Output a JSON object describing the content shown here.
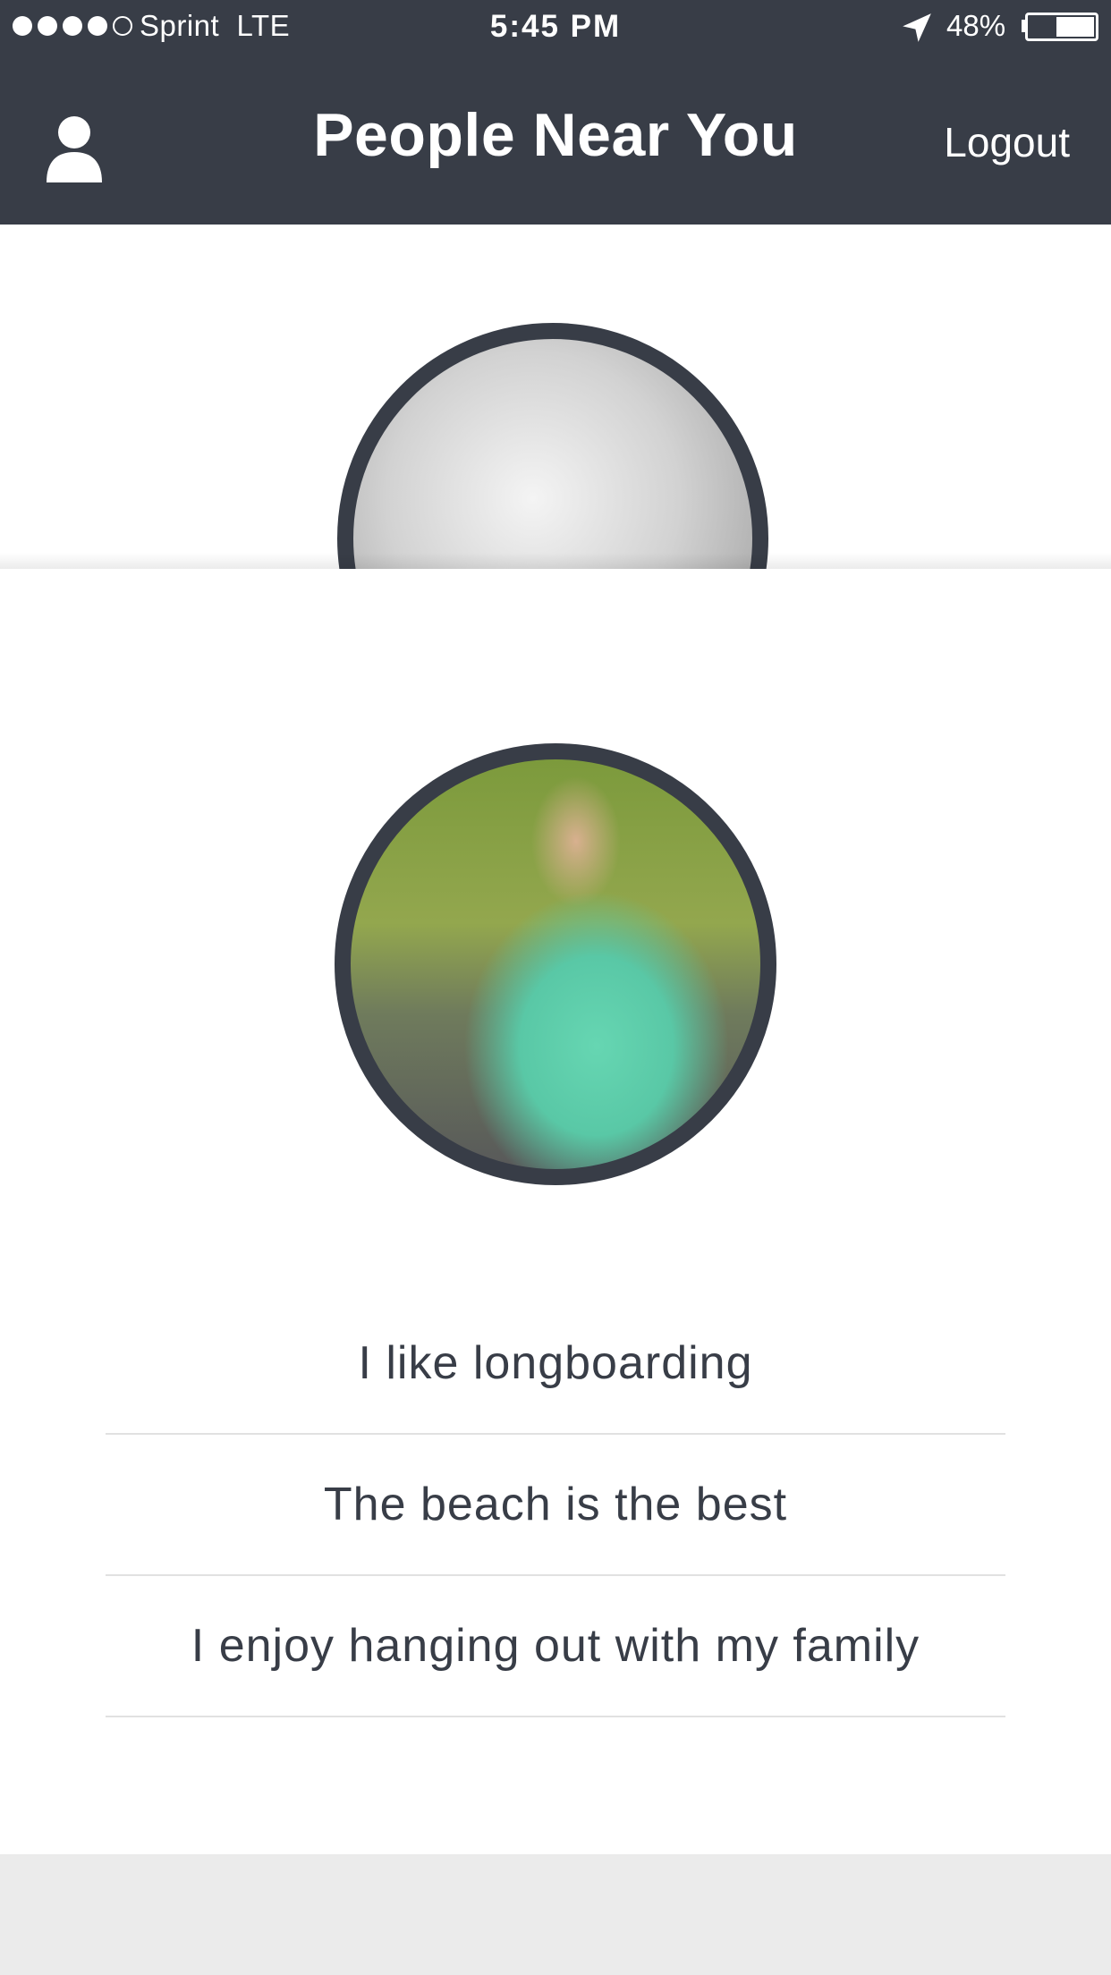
{
  "status_bar": {
    "carrier": "Sprint  LTE",
    "time": "5:45 PM",
    "battery": "48%",
    "battery_level": 0.48,
    "signal_strength": 4,
    "signal_max": 5
  },
  "nav": {
    "title": "People Near You",
    "logout_label": "Logout",
    "profile_icon": "person-icon"
  },
  "bio": {
    "items": [
      "I like longboarding",
      "The beach is the best",
      "I enjoy hanging out with my family"
    ]
  },
  "colors": {
    "header": "#383d47",
    "text": "#383d47",
    "divider": "#e1e1e1",
    "footer": "#ebebeb"
  }
}
